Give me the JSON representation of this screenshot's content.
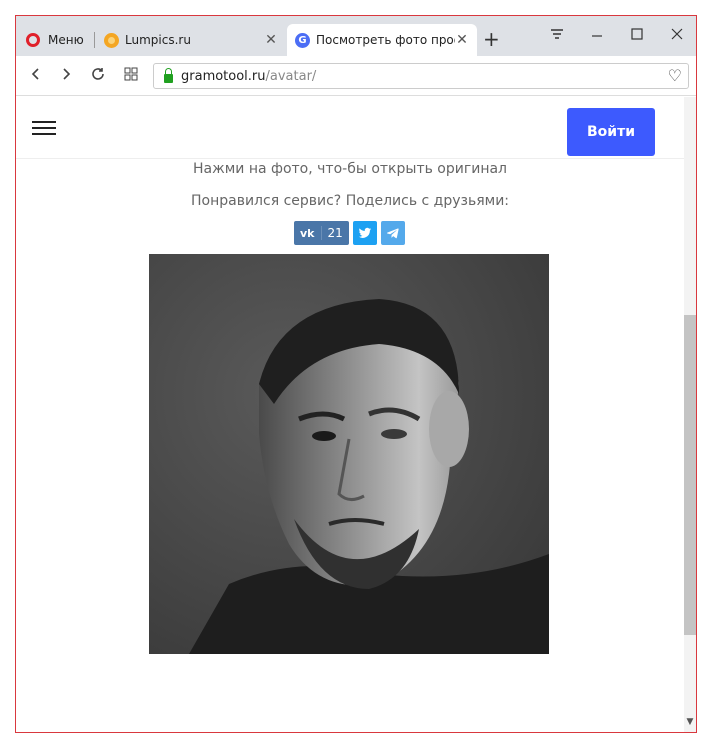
{
  "browser": {
    "menu_label": "Меню",
    "tabs": [
      {
        "title": "Lumpics.ru",
        "active": false
      },
      {
        "title": "Посмотреть фото проф",
        "active": true
      }
    ],
    "new_tab_label": "+",
    "url_domain": "gramotool.ru",
    "url_path": "/avatar/"
  },
  "site": {
    "login_label": "Войти",
    "hint_text": "Нажми на фото, что-бы открыть оригинал",
    "share_prompt": "Понравился сервис? Поделись с друзьями:",
    "share": {
      "vk_label": "vk",
      "vk_count": "21"
    }
  },
  "colors": {
    "accent": "#3d5afe",
    "vk": "#4a76a8",
    "twitter": "#1da1f2",
    "telegram": "#54a9eb",
    "window_border": "#d9383e"
  }
}
